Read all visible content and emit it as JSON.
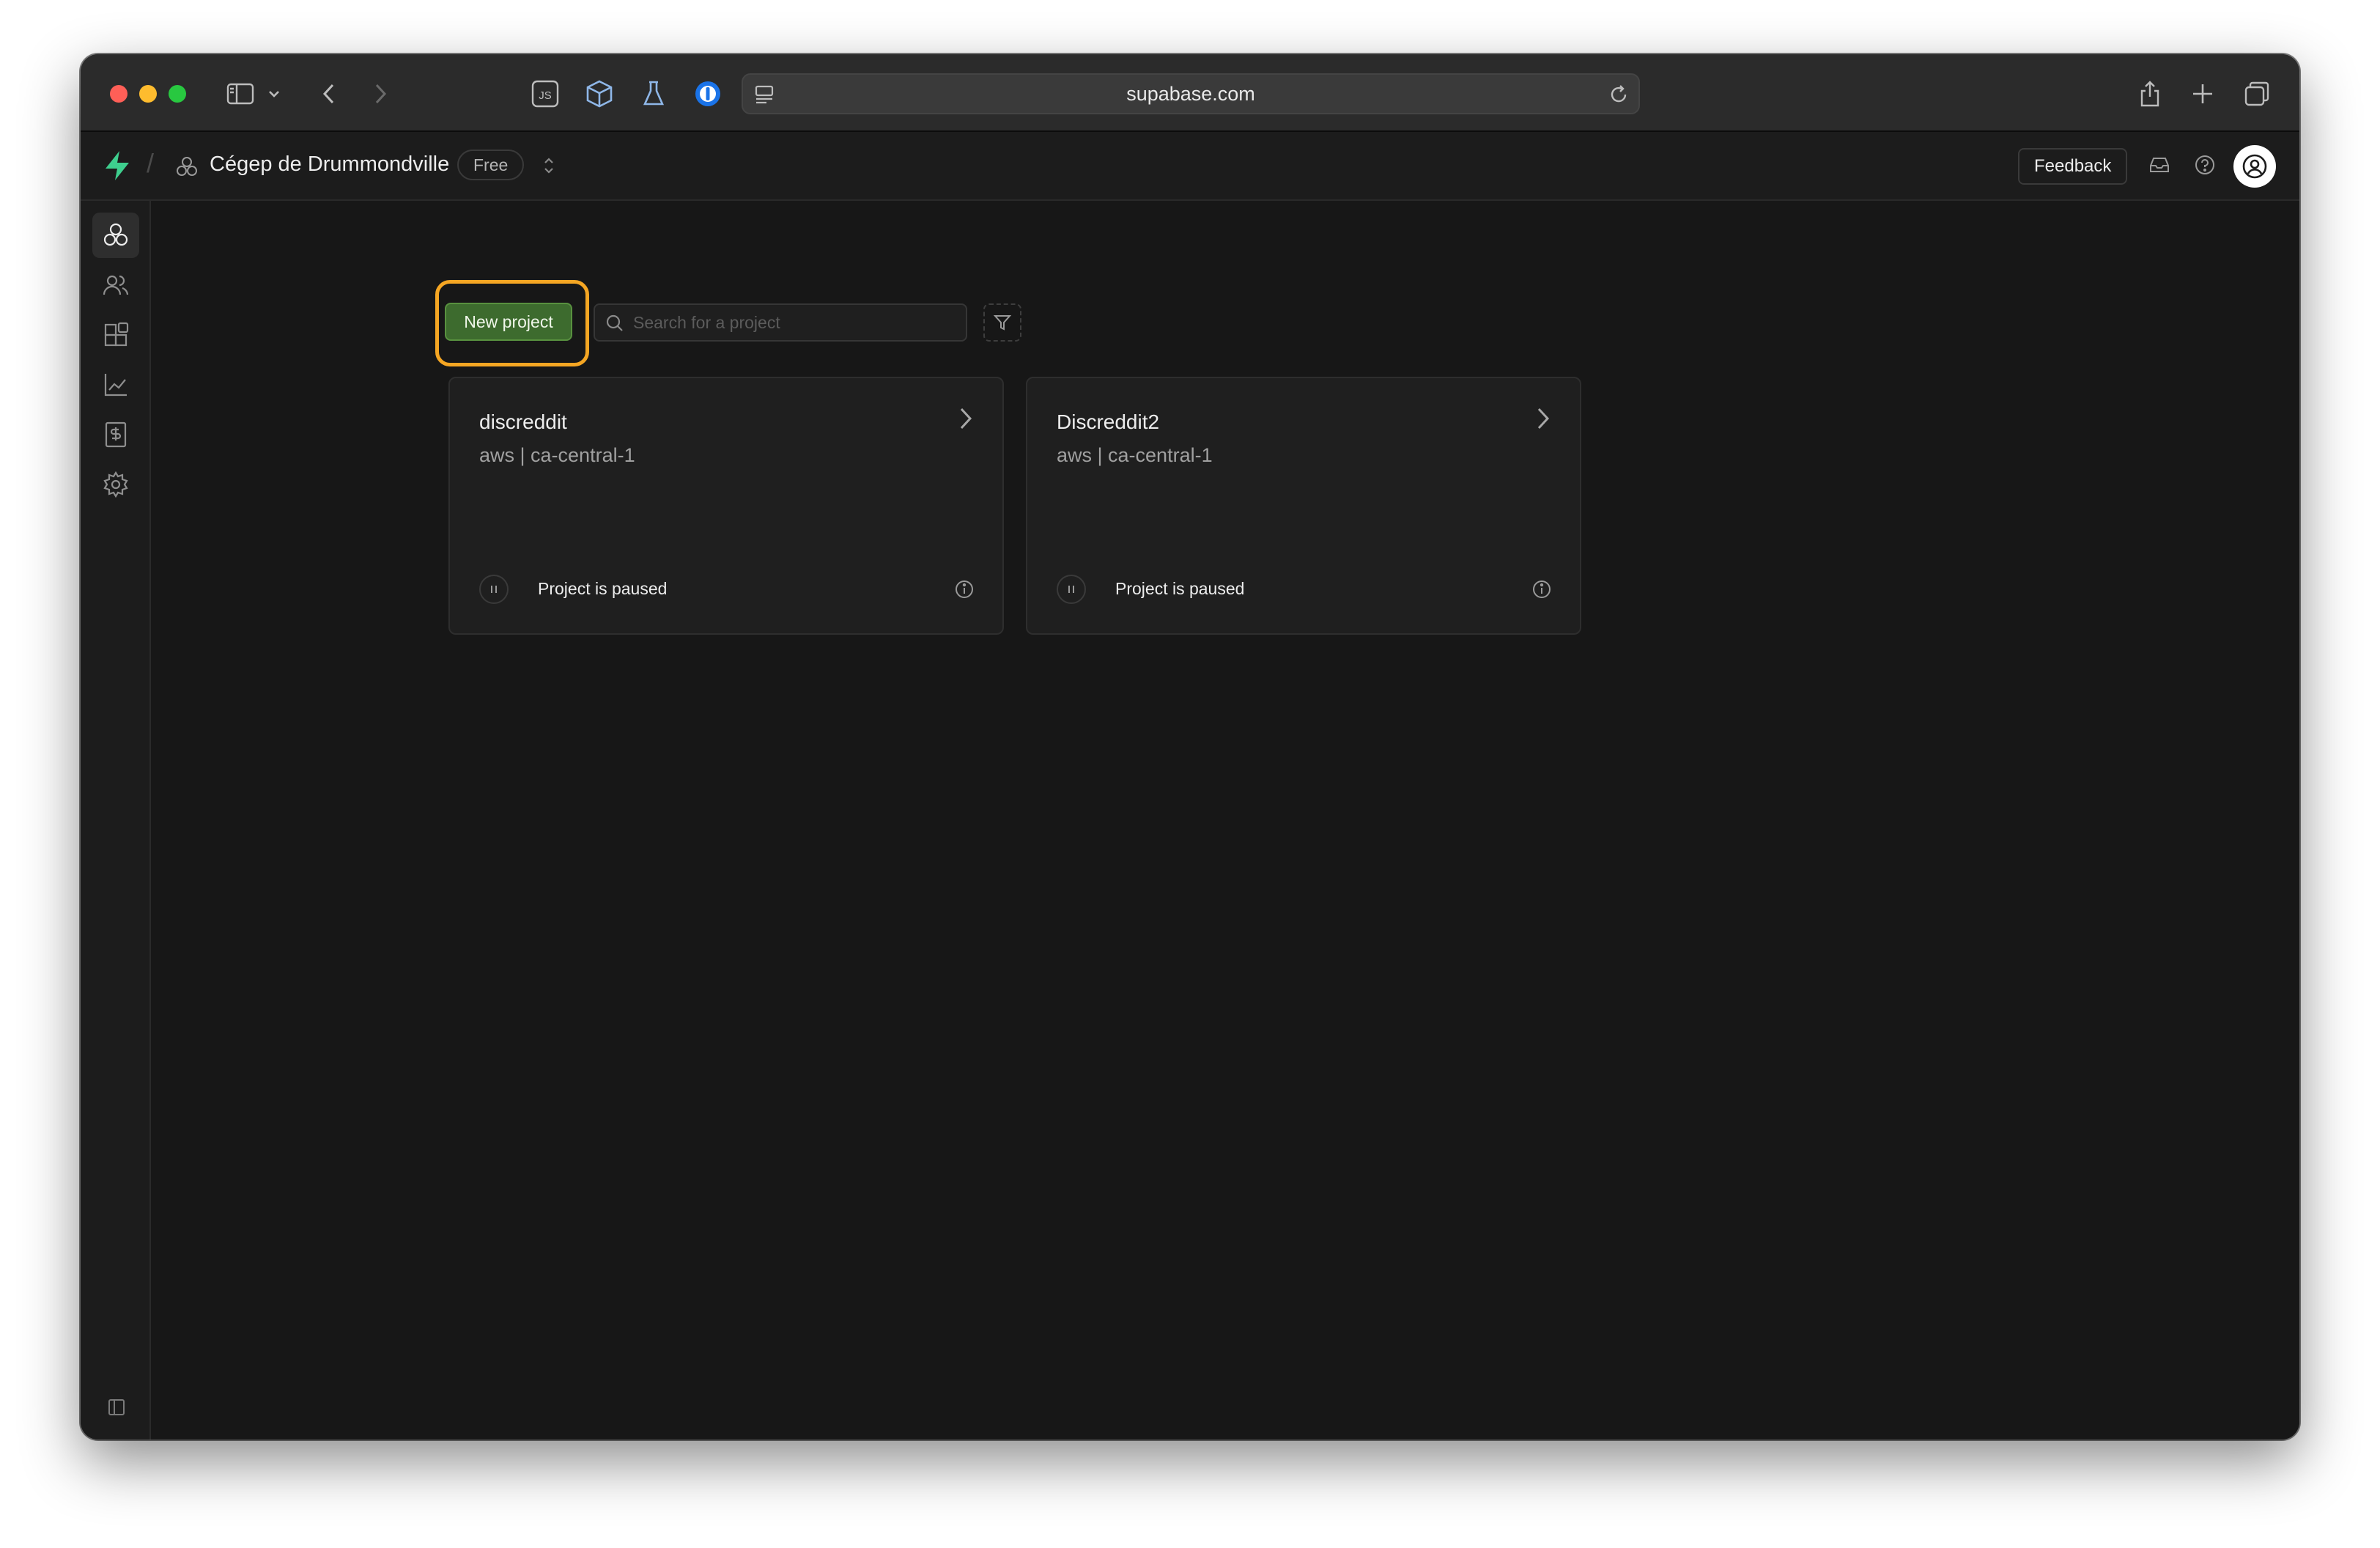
{
  "browser": {
    "url": "supabase.com"
  },
  "header": {
    "org_name": "Cégep de Drummondville",
    "plan": "Free",
    "feedback_label": "Feedback"
  },
  "toolbar": {
    "new_project_label": "New project",
    "search_placeholder": "Search for a project"
  },
  "projects": [
    {
      "name": "discreddit",
      "region": "aws | ca-central-1",
      "status": "Project is paused"
    },
    {
      "name": "Discreddit2",
      "region": "aws | ca-central-1",
      "status": "Project is paused"
    }
  ],
  "sidebar": {
    "items": [
      "projects-icon",
      "team-icon",
      "integrations-icon",
      "usage-icon",
      "billing-icon",
      "settings-icon"
    ]
  },
  "colors": {
    "accent_green": "#3ecf8e",
    "highlight": "#f5a623",
    "button_green": "#3d6b2e"
  }
}
